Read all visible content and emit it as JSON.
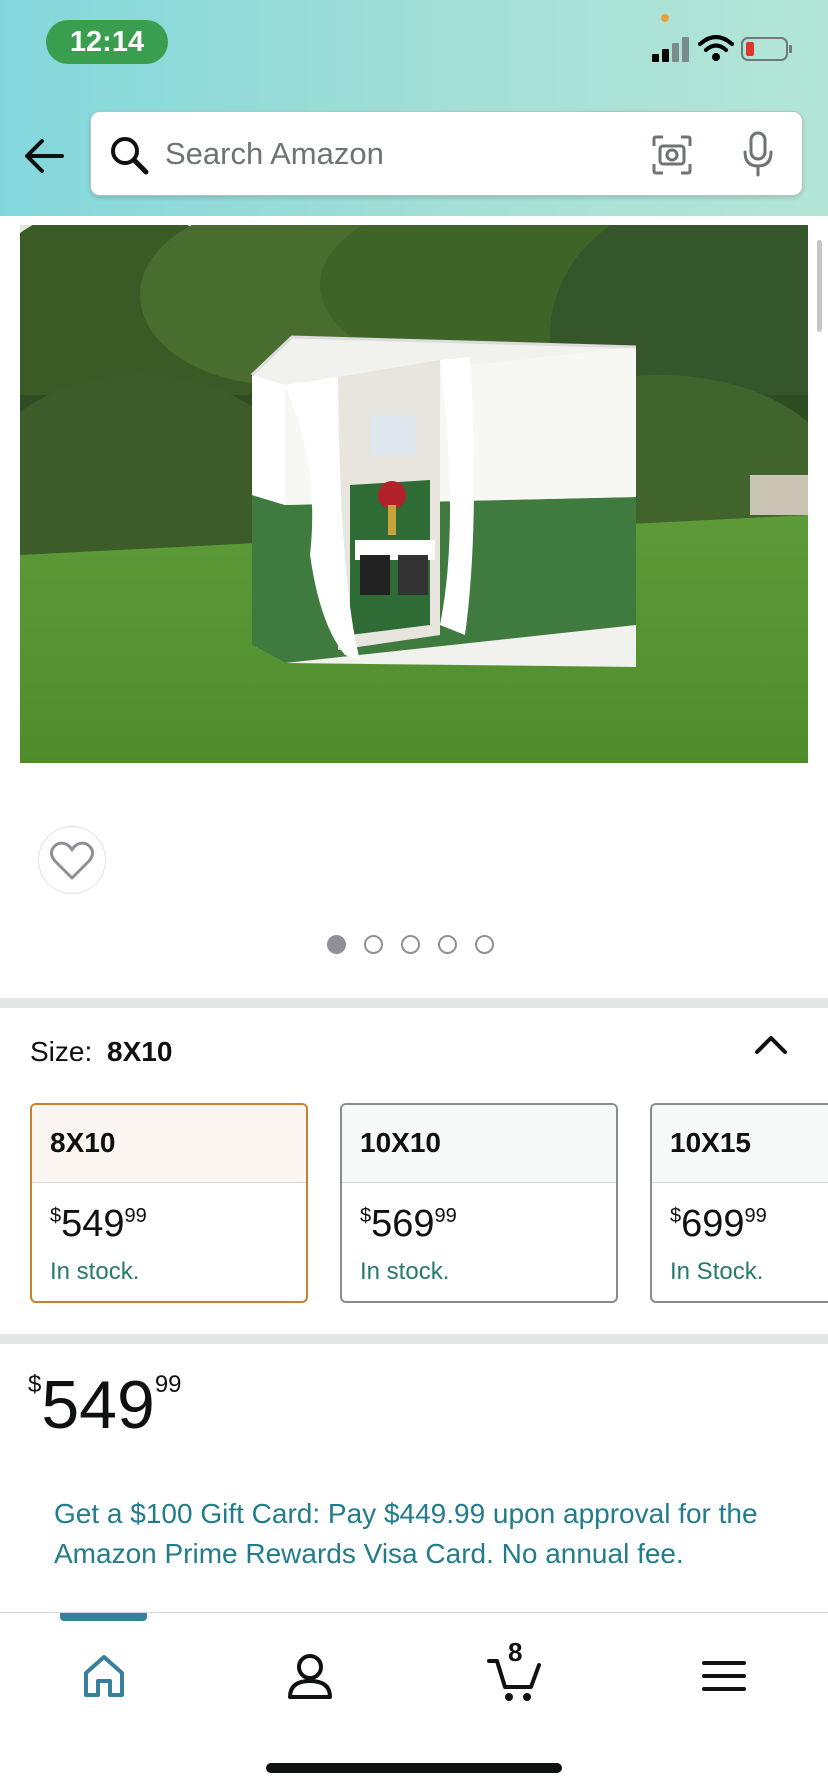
{
  "status_bar": {
    "time": "12:14"
  },
  "search": {
    "placeholder": "Search Amazon"
  },
  "product": {
    "image_alt": "White and green sukkah tent on a lawn"
  },
  "gallery": {
    "pages": 5,
    "active_page": 1
  },
  "size_selector": {
    "label": "Size:",
    "selected": "8X10",
    "options": [
      {
        "name": "8X10",
        "price_symbol": "$",
        "price_whole": "549",
        "price_fraction": "99",
        "stock": "In stock."
      },
      {
        "name": "10X10",
        "price_symbol": "$",
        "price_whole": "569",
        "price_fraction": "99",
        "stock": "In stock."
      },
      {
        "name": "10X15",
        "price_symbol": "$",
        "price_whole": "699",
        "price_fraction": "99",
        "stock": "In Stock."
      }
    ]
  },
  "price": {
    "symbol": "$",
    "whole": "549",
    "fraction": "99"
  },
  "promo": {
    "text": "Get a $100 Gift Card: Pay $449.99 upon approval for the Amazon Prime Rewards Visa Card. No annual fee."
  },
  "tabbar": {
    "cart_count": "8"
  },
  "colors": {
    "accent_teal": "#37809a",
    "selected_border": "#c7812f",
    "stock_green": "#257a6a",
    "link_teal": "#237c8c"
  }
}
